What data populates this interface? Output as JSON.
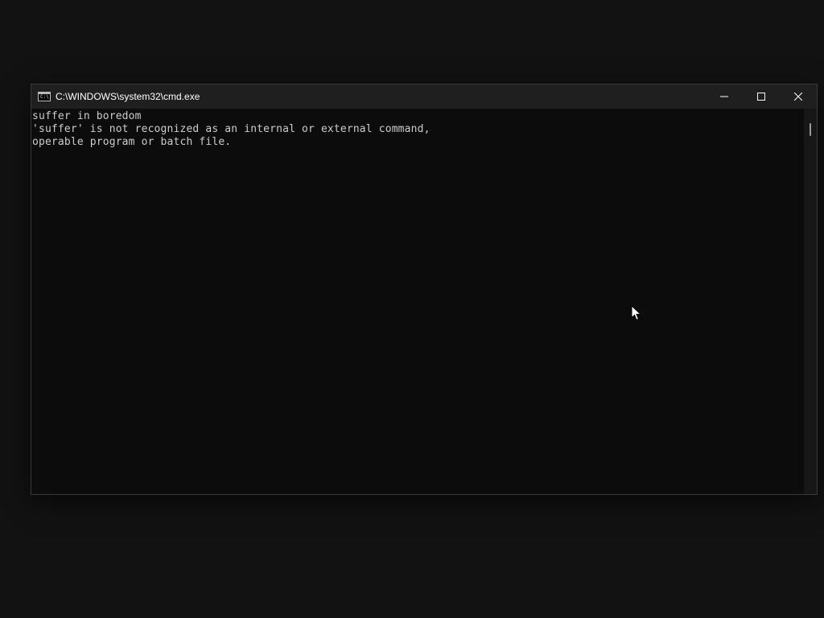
{
  "window": {
    "title": "C:\\WINDOWS\\system32\\cmd.exe",
    "icon": "cmd-app-icon",
    "icon_glyph": "C:\\."
  },
  "caption_buttons": {
    "minimize": "minimize-icon",
    "maximize": "maximize-icon",
    "close": "close-icon"
  },
  "console": {
    "lines": [
      "suffer in boredom",
      "'suffer' is not recognized as an internal or external command,",
      "operable program or batch file."
    ]
  },
  "colors": {
    "background": "#0c0c0c",
    "text": "#cccccc",
    "titlebar": "#1f1f1f",
    "desktop": "#121212"
  }
}
